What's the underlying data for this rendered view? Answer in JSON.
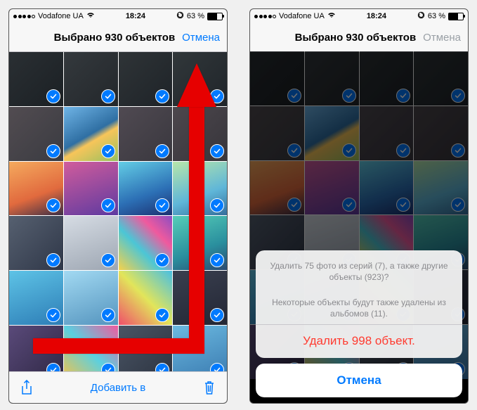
{
  "status": {
    "carrier": "Vodafone UA",
    "time": "18:24",
    "battery_pct": "63 %"
  },
  "left": {
    "title": "Выбрано 930 объектов",
    "cancel": "Отмена",
    "add_to": "Добавить в"
  },
  "right": {
    "title": "Выбрано 930 объектов",
    "cancel": "Отмена",
    "alert_line1": "Удалить 75 фото из серий (7), а также другие объекты (923)?",
    "alert_line2": "Некоторые объекты будут также удалены из альбомов (11).",
    "delete_btn": "Удалить 998 объект.",
    "sheet_cancel": "Отмена"
  },
  "thumb_colors": [
    "linear-gradient(135deg,#2a2f33,#1b2024)",
    "linear-gradient(135deg,#34393d,#23272b)",
    "linear-gradient(135deg,#2f3437,#1e2328)",
    "linear-gradient(135deg,#31373a,#20252a)",
    "linear-gradient(135deg,#524c51,#3a3b41)",
    "linear-gradient(150deg,#6fb4e6,#2f6fa3 50%,#f7c55a 60%,#97c05f)",
    "linear-gradient(135deg,#504a52,#39373e)",
    "linear-gradient(135deg,#4d474d,#37353b)",
    "linear-gradient(160deg,#f5aa5e,#e16a3e 60%,#3a2e46)",
    "linear-gradient(160deg,#d15c9c,#5e3aa0)",
    "linear-gradient(160deg,#63cde5,#2c6fb5 60%,#1b3070)",
    "linear-gradient(160deg,#b7e6a9,#5fb6d8 60%,#356e9c)",
    "linear-gradient(135deg,#566070,#2f3748)",
    "linear-gradient(160deg,#d6dce4,#9da6b2)",
    "linear-gradient(45deg,#f6d14a,#4bc6d6 40%,#ef5a9e 70%,#8b4dc3)",
    "linear-gradient(160deg,#56cdb8,#2a8f9e 60%,#2a4a72)",
    "linear-gradient(160deg,#5ec3e6,#2d7db6)",
    "linear-gradient(160deg,#a2d9f2,#5494be)",
    "linear-gradient(45deg,#ef4f6a,#e2e55a 50%,#48bfe3)",
    "linear-gradient(160deg,#3a3f4f,#232735)",
    "linear-gradient(135deg,#5a4a7a,#2e2744)",
    "linear-gradient(45deg,#f4c24a,#5bd0e0 50%,#f05a9e)",
    "linear-gradient(135deg,#4a5565,#2c3340)",
    "linear-gradient(160deg,#6bb9e0,#3a7ab0)"
  ]
}
